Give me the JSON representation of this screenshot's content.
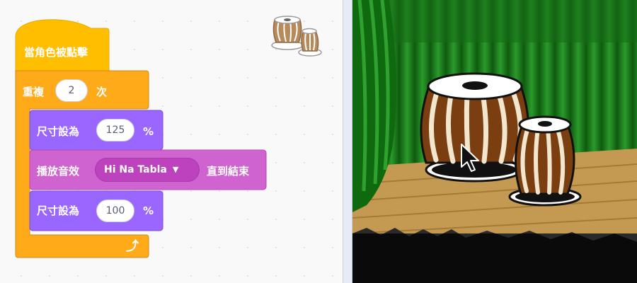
{
  "code": {
    "hat_block": "當角色被點擊",
    "repeat": {
      "label": "重複",
      "count": "2",
      "suffix": "次"
    },
    "set_size_1": {
      "label": "尺寸設為",
      "value": "125",
      "unit": "%"
    },
    "play_sound": {
      "label": "播放音效",
      "sound": "Hi Na Tabla",
      "suffix": "直到結束"
    },
    "set_size_2": {
      "label": "尺寸設為",
      "value": "100",
      "unit": "%"
    }
  },
  "colors": {
    "events": "#ffbf00",
    "control": "#ffab19",
    "looks": "#9966ff",
    "sound": "#cf63cf",
    "stage_curtain": "#1a7a1a",
    "stage_floor": "#c49a52"
  },
  "icons": {
    "sprite_thumbnail": "tabla-drums-icon",
    "loop_arrow": "loop-arrow-icon",
    "dropdown": "caret-down-icon",
    "cursor": "mouse-pointer-icon"
  }
}
